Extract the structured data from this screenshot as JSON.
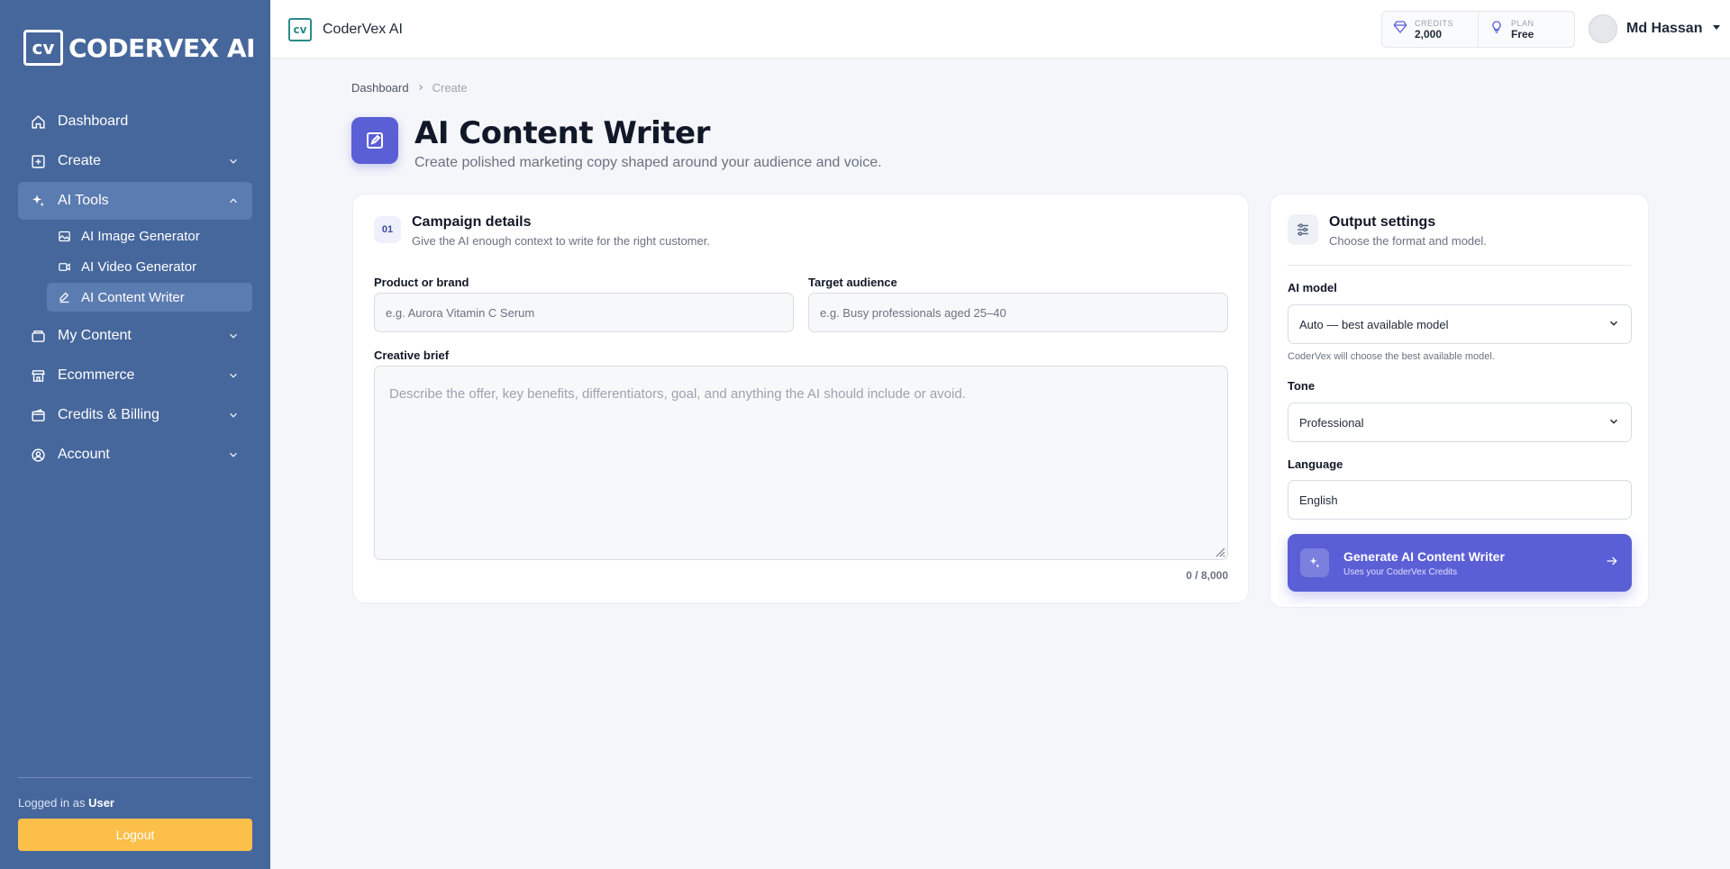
{
  "sidebar": {
    "logo_mark": "cv",
    "logo_text": "CODERVEX AI",
    "nav": [
      {
        "label": "Dashboard",
        "icon": "home-icon"
      },
      {
        "label": "Create",
        "icon": "plus-square-icon"
      },
      {
        "label": "AI Tools",
        "icon": "sparkles-icon"
      },
      {
        "label": "My Content",
        "icon": "folder-icon"
      },
      {
        "label": "Ecommerce",
        "icon": "store-icon"
      },
      {
        "label": "Credits & Billing",
        "icon": "wallet-icon"
      },
      {
        "label": "Account",
        "icon": "user-circle-icon"
      }
    ],
    "ai_tools_sub": [
      {
        "label": "AI Image Generator",
        "icon": "image-icon"
      },
      {
        "label": "AI Video Generator",
        "icon": "video-icon"
      },
      {
        "label": "AI Content Writer",
        "icon": "pencil-square-icon"
      }
    ],
    "logged_prefix": "Logged in as",
    "logged_user": "User",
    "logout_label": "Logout"
  },
  "topbar": {
    "brand_mark": "cv",
    "brand": "CoderVex AI",
    "credits_label": "CREDITS",
    "credits_value": "2,000",
    "plan_label": "PLAN",
    "plan_value": "Free",
    "user_name": "Md Hassan"
  },
  "breadcrumb": {
    "first": "Dashboard",
    "second": "Create"
  },
  "page": {
    "title": "AI Content Writer",
    "subtitle": "Create polished marketing copy shaped around your audience and voice."
  },
  "campaign": {
    "number": "01",
    "title": "Campaign details",
    "subtitle": "Give the AI enough context to write for the right customer.",
    "product_label": "Product or brand",
    "product_placeholder": "e.g. Aurora Vitamin C Serum",
    "audience_label": "Target audience",
    "audience_placeholder": "e.g. Busy professionals aged 25–40",
    "brief_label": "Creative brief",
    "brief_placeholder": "Describe the offer, key benefits, differentiators, goal, and anything the AI should include or avoid.",
    "char_count": "0 / 8,000"
  },
  "output": {
    "title": "Output settings",
    "subtitle": "Choose the format and model.",
    "model_label": "AI model",
    "model_value": "Auto — best available model",
    "model_hint": "CoderVex will choose the best available model.",
    "tone_label": "Tone",
    "tone_value": "Professional",
    "language_label": "Language",
    "language_value": "English",
    "generate_title": "Generate AI Content Writer",
    "generate_sub": "Uses your CoderVex Credits"
  },
  "colors": {
    "sidebar": "#46679c",
    "accent": "#5b5fd6",
    "logout": "#fbbf4a"
  }
}
